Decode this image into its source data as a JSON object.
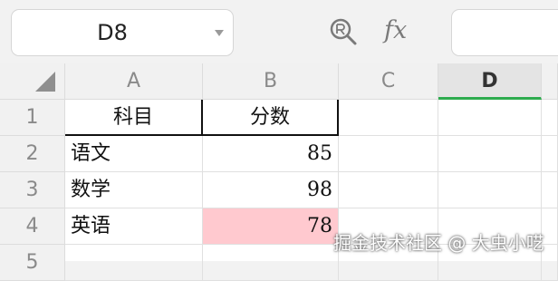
{
  "name_box": {
    "value": "D8"
  },
  "toolbar": {
    "fx_label": "fx"
  },
  "columns": [
    "A",
    "B",
    "C",
    "D"
  ],
  "active_column": "D",
  "rows": [
    "1",
    "2",
    "3",
    "4",
    "5"
  ],
  "cells": {
    "A1": "科目",
    "B1": "分数",
    "A2": "语文",
    "B2": "85",
    "A3": "数学",
    "B3": "98",
    "A4": "英语",
    "B4": "78"
  },
  "highlight": {
    "cell": "B4",
    "color": "#ffc9cf"
  },
  "accent_color": "#2eab4e",
  "watermark": "掘金技术社区 @ 大虫小呓"
}
